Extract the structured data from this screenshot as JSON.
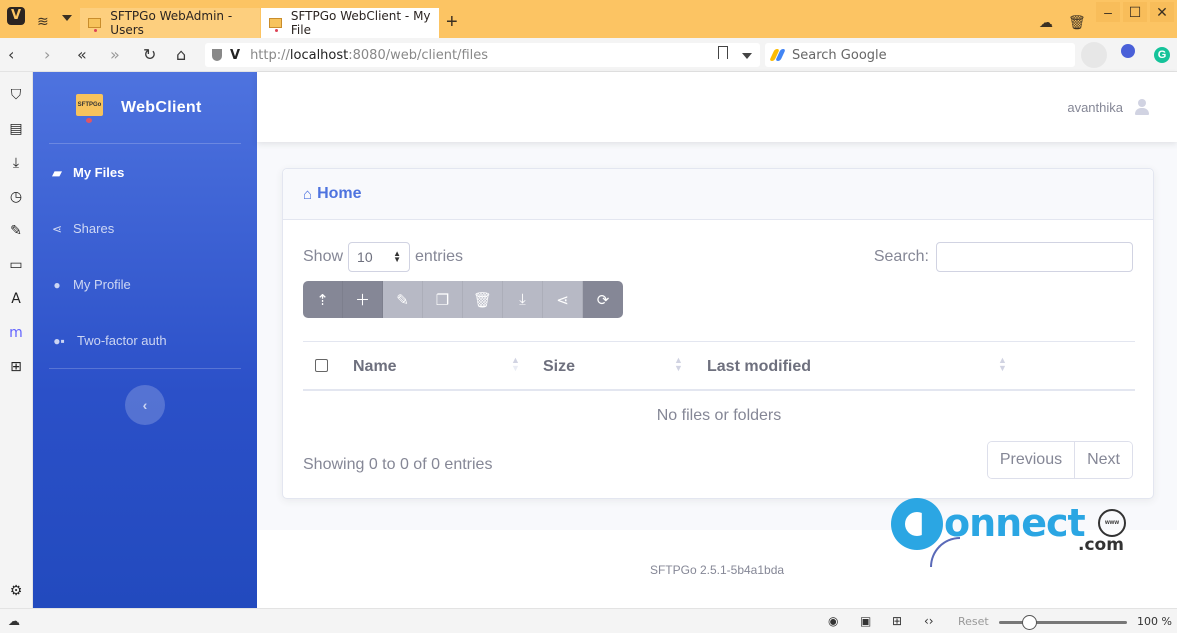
{
  "browser": {
    "tabs": [
      {
        "title": "SFTPGo WebAdmin - Users",
        "active": false
      },
      {
        "title": "SFTPGo WebClient - My File",
        "active": true
      }
    ],
    "url": {
      "scheme": "http://",
      "host": "localhost",
      "path": ":8080/web/client/files"
    },
    "search_placeholder": "Search Google",
    "window_controls": {
      "minimize": "–",
      "maximize": "☐",
      "close": "✕"
    },
    "status": {
      "reset_label": "Reset",
      "zoom_level": "100 %",
      "zoom_fraction": 0.2
    }
  },
  "sidebar": {
    "brand": "WebClient",
    "logo_text": "SFTPGo",
    "items": [
      {
        "label": "My Files",
        "icon": "folder-open-icon",
        "active": true
      },
      {
        "label": "Shares",
        "icon": "share-icon",
        "active": false
      },
      {
        "label": "My Profile",
        "icon": "user-icon",
        "active": false
      },
      {
        "label": "Two-factor auth",
        "icon": "user-lock-icon",
        "active": false
      }
    ],
    "toggle": "‹"
  },
  "topbar": {
    "username": "avanthika"
  },
  "card": {
    "title": "Home",
    "length": {
      "prefix": "Show",
      "value": "10",
      "suffix": "entries"
    },
    "search_label": "Search:",
    "search_value": "",
    "toolbar": [
      {
        "name": "upload-file",
        "glyph": "⇡",
        "enabled": true
      },
      {
        "name": "add-folder",
        "glyph": "＋",
        "enabled": true
      },
      {
        "name": "rename",
        "glyph": "✎",
        "enabled": false
      },
      {
        "name": "copy",
        "glyph": "❐",
        "enabled": false
      },
      {
        "name": "delete",
        "glyph": "🗑",
        "enabled": false
      },
      {
        "name": "download",
        "glyph": "⤓",
        "enabled": false
      },
      {
        "name": "share",
        "glyph": "⋖",
        "enabled": false
      },
      {
        "name": "refresh",
        "glyph": "⟳",
        "enabled": true
      }
    ],
    "table": {
      "columns": [
        "Name",
        "Size",
        "Last modified"
      ],
      "empty_message": "No files or folders"
    },
    "info": "Showing 0 to 0 of 0 entries",
    "pager": {
      "previous": "Previous",
      "next": "Next"
    }
  },
  "footer": {
    "version": "SFTPGo 2.5.1-5b4a1bda"
  },
  "watermark": {
    "text": "onnect",
    "suffix": ".com",
    "globe": "www"
  }
}
